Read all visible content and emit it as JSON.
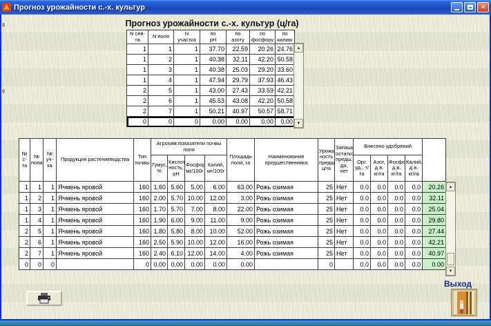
{
  "window": {
    "title": "Прогноз урожайности с.-х. культур",
    "controls": {
      "close": "✕"
    }
  },
  "heading": "Прогноз урожайности с.-х. культур (ц/га)",
  "icons": {
    "scroll_up": "▲",
    "scroll_down": "▼"
  },
  "top_table": {
    "headers": [
      "N сев-та",
      "N поля",
      "N\nучастка",
      "по\npH",
      "по\nазоту",
      "по\nфосфору",
      "по\nкалию"
    ],
    "rows": [
      [
        "1",
        "1",
        "1",
        "37.70",
        "22.59",
        "20.26",
        "24.76"
      ],
      [
        "1",
        "2",
        "1",
        "40.38",
        "32.11",
        "42.20",
        "50.58"
      ],
      [
        "1",
        "3",
        "1",
        "40.38",
        "25.03",
        "29.20",
        "33.60"
      ],
      [
        "1",
        "4",
        "1",
        "47.94",
        "29.79",
        "37.93",
        "46.43"
      ],
      [
        "2",
        "5",
        "1",
        "43.00",
        "27.43",
        "33.59",
        "42.21"
      ],
      [
        "2",
        "6",
        "1",
        "45.53",
        "43.08",
        "42.20",
        "50.58"
      ],
      [
        "2",
        "7",
        "1",
        "50.21",
        "40.97",
        "50.57",
        "58.71"
      ],
      [
        "0",
        "0",
        "0",
        "0.00",
        "0.00",
        "0.00",
        "0.00"
      ]
    ]
  },
  "bottom_table": {
    "header_main": [
      "№\nс-та",
      "№\nполя",
      "№\nуч-ка",
      "Продукция растениеводства",
      "Тип\nпочвы",
      "Агрохим.показатели почвы\nполя",
      "Площадь\nполя, га",
      "Наименование предшественника",
      "Урожай\nность\nпредш.,\nц/га",
      "Запашка\nостатков\nпредш.,\nда, нет",
      "Внесено  удобрений",
      ""
    ],
    "header_sub": [
      "Гумус,\n%",
      "Кислот\nность,\npH",
      "Фосфор,\nмг/100г",
      "Калий,\nмг/100г",
      "Орг.\nуд., т/га",
      "Азот,\nд.в.\nкг/га",
      "Фосфор,\nд.в.\nкг/га",
      "Калий,\nд.в.\nкг/га"
    ],
    "rows": [
      [
        "1",
        "1",
        "1",
        "Ячмень яровой",
        "160",
        "1.60",
        "5.60",
        "5.00",
        "6.00",
        "63.00",
        "Рожь озимая",
        "25",
        "Нет",
        "0.0",
        "0.0",
        "0.0",
        "0.0",
        "20.26"
      ],
      [
        "1",
        "2",
        "1",
        "Ячмень яровой",
        "160",
        "2.00",
        "5.70",
        "10.00",
        "12.00",
        "3.00",
        "Рожь озимая",
        "25",
        "Нет",
        "0.0",
        "0.0",
        "0.0",
        "0.0",
        "32.11"
      ],
      [
        "1",
        "3",
        "1",
        "Ячмень яровой",
        "160",
        "1.70",
        "5.70",
        "7.00",
        "8.00",
        "22.00",
        "Рожь озимая",
        "25",
        "Нет",
        "0.0",
        "0.0",
        "0.0",
        "0.0",
        "25.04"
      ],
      [
        "1",
        "4",
        "1",
        "Ячмень яровой",
        "160",
        "1.90",
        "6.00",
        "9.00",
        "11.00",
        "9.00",
        "Рожь озимая",
        "25",
        "Нет",
        "0.0",
        "0.0",
        "0.0",
        "0.0",
        "29.80"
      ],
      [
        "2",
        "5",
        "1",
        "Ячмень яровой",
        "160",
        "1.80",
        "5.80",
        "8.00",
        "10.00",
        "52.00",
        "Рожь озимая",
        "25",
        "Нет",
        "0.0",
        "0.0",
        "0.0",
        "0.0",
        "27.44"
      ],
      [
        "2",
        "6",
        "1",
        "Ячмень яровой",
        "160",
        "2.50",
        "5.90",
        "10.00",
        "12.00",
        "16.00",
        "Рожь озимая",
        "25",
        "Нет",
        "0.0",
        "0.0",
        "0.0",
        "0.0",
        "42.21"
      ],
      [
        "2",
        "7",
        "1",
        "Ячмень яровой",
        "160",
        "2.40",
        "6.10",
        "12.00",
        "14.00",
        "4.00",
        "Рожь озимая",
        "25",
        "Нет",
        "0.0",
        "0.0",
        "0.0",
        "0.0",
        "40.97"
      ],
      [
        "0",
        "0",
        "0",
        "",
        "0",
        "0.00",
        "0.00",
        "0.00",
        "0.00",
        "0.00",
        "",
        "0",
        "",
        "0.0",
        "0.0",
        "0.0",
        "0.0",
        "0.00"
      ]
    ]
  },
  "buttons": {
    "exit_label": "Выход"
  },
  "colors": {
    "forecast_highlight": "#c9f2c9",
    "titlebar_blue": "#2663e0",
    "window_border": "#0831d9",
    "taskbar_strip": "#2e7fae",
    "exit_label_blue": "#14298c"
  }
}
